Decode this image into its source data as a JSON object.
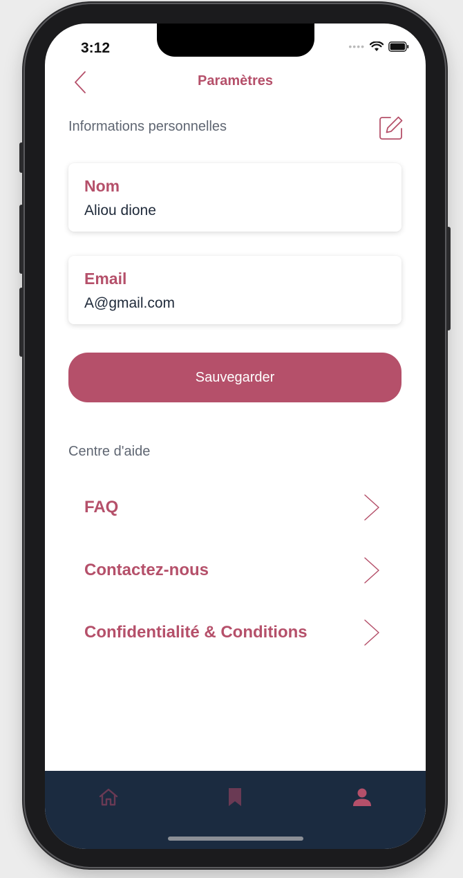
{
  "status_bar": {
    "time": "3:12"
  },
  "header": {
    "title": "Paramètres"
  },
  "personal_info": {
    "section_label": "Informations personnelles",
    "name_field": {
      "label": "Nom",
      "value": "Aliou dione"
    },
    "email_field": {
      "label": "Email",
      "value": "A@gmail.com"
    },
    "save_label": "Sauvegarder"
  },
  "help_center": {
    "section_label": "Centre d'aide",
    "items": [
      {
        "label": "FAQ"
      },
      {
        "label": "Contactez-nous"
      },
      {
        "label": "Confidentialité & Conditions"
      }
    ]
  },
  "tab_bar": {
    "tabs": [
      {
        "icon": "home-icon",
        "active": false
      },
      {
        "icon": "bookmark-icon",
        "active": false
      },
      {
        "icon": "user-icon",
        "active": true
      }
    ]
  },
  "colors": {
    "accent": "#b5506a",
    "tabbar_bg": "#1b2b40",
    "tab_inactive": "#6a3a54",
    "text_dark": "#1f2a3a",
    "text_muted": "#5f6672"
  }
}
